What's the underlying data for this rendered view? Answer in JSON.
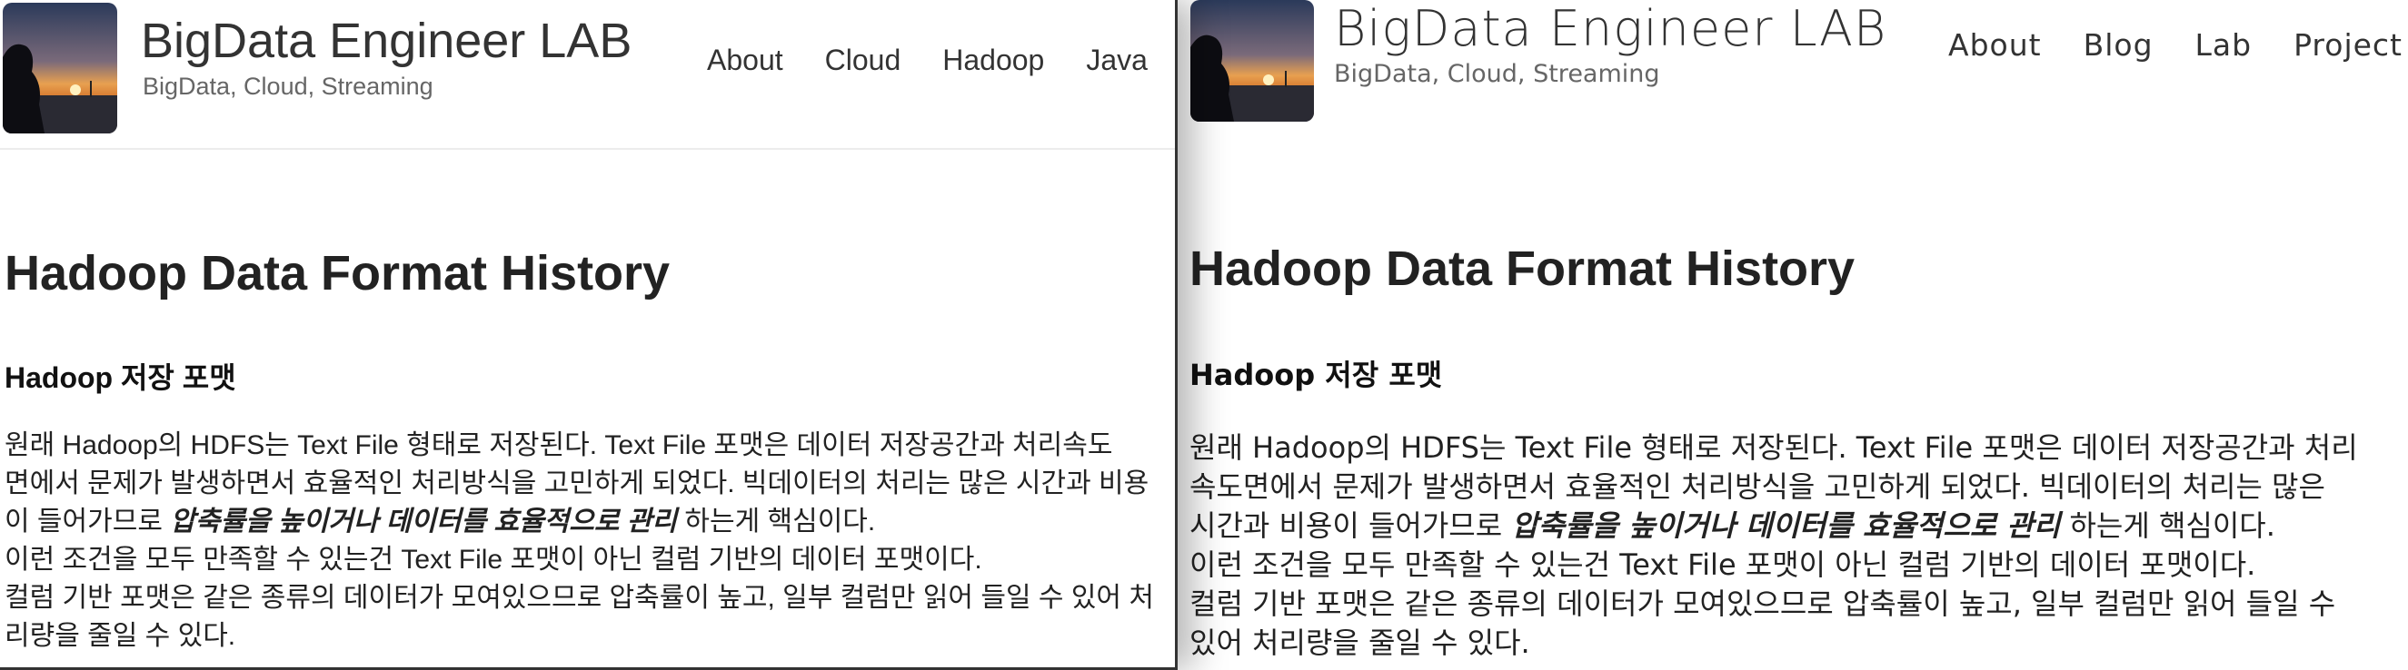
{
  "site": {
    "title": "BigData Engineer LAB",
    "subtitle": "BigData, Cloud, Streaming"
  },
  "left_pane": {
    "nav": [
      "About",
      "Cloud",
      "Hadoop",
      "Java"
    ],
    "post_title": "Hadoop Data Format History",
    "section_title": "Hadoop 저장 포맷",
    "lines": [
      {
        "before": "원래 Hadoop의 HDFS는 Text File 형태로 저장된다. Text File 포맷은 데이터 저장공간과 처리속도",
        "emph": "",
        "after": ""
      },
      {
        "before": "면에서 문제가 발생하면서 효율적인 처리방식을 고민하게 되었다. 빅데이터의 처리는 많은 시간과 비용",
        "emph": "",
        "after": ""
      },
      {
        "before": "이 들어가므로 ",
        "emph": "압축률을 높이거나 데이터를 효율적으로 관리",
        "after": " 하는게 핵심이다."
      },
      {
        "before": "이런 조건을 모두 만족할 수 있는건 Text File 포맷이 아닌 컬럼 기반의 데이터 포맷이다.",
        "emph": "",
        "after": ""
      },
      {
        "before": "컬럼 기반 포맷은 같은 종류의 데이터가 모여있으므로 압축률이 높고, 일부 컬럼만 읽어 들일 수 있어 처",
        "emph": "",
        "after": ""
      },
      {
        "before": "리량을 줄일 수 있다.",
        "emph": "",
        "after": ""
      }
    ]
  },
  "right_pane": {
    "nav": [
      "About",
      "Blog",
      "Lab",
      "Project"
    ],
    "post_title": "Hadoop Data Format History",
    "section_title": "Hadoop 저장 포맷",
    "lines": [
      {
        "before": "원래 Hadoop의 HDFS는 Text File 형태로 저장된다. Text File 포맷은 데이터 저장공간과 처리",
        "emph": "",
        "after": ""
      },
      {
        "before": "속도면에서 문제가 발생하면서 효율적인 처리방식을 고민하게 되었다. 빅데이터의 처리는 많은",
        "emph": "",
        "after": ""
      },
      {
        "before": "시간과 비용이 들어가므로 ",
        "emph": "압축률을 높이거나 데이터를 효율적으로 관리",
        "after": " 하는게 핵심이다."
      },
      {
        "before": "이런 조건을 모두 만족할 수 있는건 Text File 포맷이 아닌 컬럼 기반의 데이터 포맷이다.",
        "emph": "",
        "after": ""
      },
      {
        "before": "컬럼 기반 포맷은 같은 종류의 데이터가 모여있으므로 압축률이 높고, 일부 컬럼만 읽어 들일 수",
        "emph": "",
        "after": ""
      },
      {
        "before": "있어 처리량을 줄일 수 있다.",
        "emph": "",
        "after": ""
      }
    ]
  },
  "colors": {
    "text": "#222222",
    "nav_text": "#333333",
    "subtitle": "#666666",
    "divider": "#ececec",
    "background": "#ffffff"
  },
  "icons": {
    "avatar": "sunset-silhouette-photo"
  }
}
